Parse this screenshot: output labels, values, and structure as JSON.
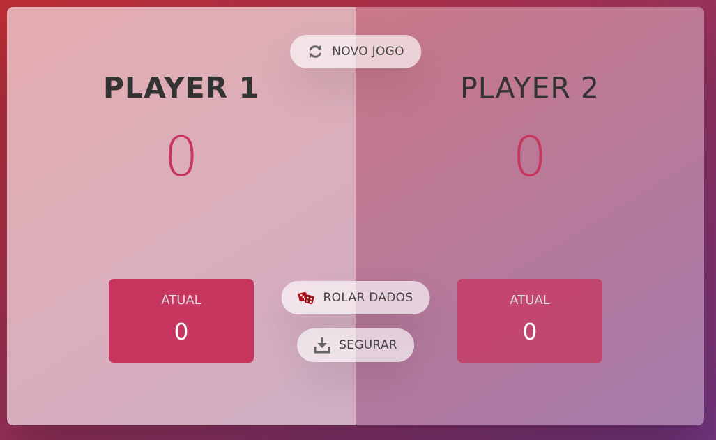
{
  "buttons": {
    "new_game": {
      "label": "NOVO JOGO",
      "icon": "refresh-icon"
    },
    "roll_dice": {
      "label": "ROLAR DADOS",
      "icon": "dice-icon"
    },
    "hold": {
      "label": "SEGURAR",
      "icon": "download-icon"
    }
  },
  "players": [
    {
      "name": "PLAYER 1",
      "score": "0",
      "current_label": "ATUAL",
      "current_score": "0",
      "active": true
    },
    {
      "name": "PLAYER 2",
      "score": "0",
      "current_label": "ATUAL",
      "current_score": "0",
      "active": false
    }
  ],
  "colors": {
    "accent": "#c7365f",
    "dice": "#b5121b",
    "background_from": "#bf2e34",
    "background_to": "#753682"
  }
}
